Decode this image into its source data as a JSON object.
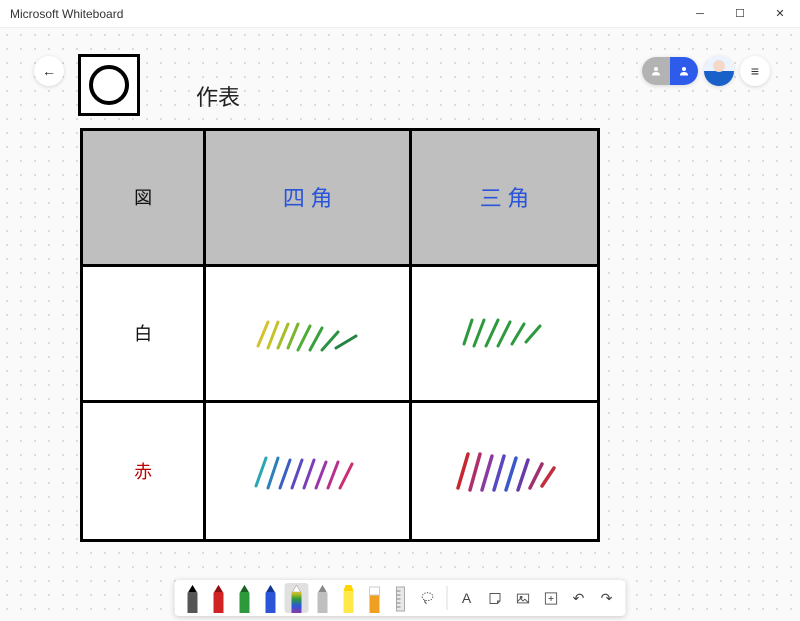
{
  "titlebar": {
    "title": "Microsoft Whiteboard"
  },
  "header": {
    "title_text": "作表",
    "share_mode_private_label": "Private",
    "share_mode_shared_label": "Shared"
  },
  "table": {
    "header": {
      "col1": "図",
      "col2": "四 角",
      "col3": "三 角"
    },
    "rows": [
      {
        "label": "白",
        "cell2_desc": "yellow-to-green crayon scribbles",
        "cell3_desc": "green crayon scribbles"
      },
      {
        "label": "赤",
        "cell2_desc": "teal-to-magenta rainbow crayon scribbles",
        "cell3_desc": "red/blue/purple rainbow crayon scribbles"
      }
    ]
  },
  "toolbar": {
    "pens": [
      {
        "name": "pen-black",
        "tip": "#000000",
        "body": "#555555",
        "selected": false
      },
      {
        "name": "pen-red",
        "tip": "#d02424",
        "body": "#d02424",
        "selected": false
      },
      {
        "name": "pen-green",
        "tip": "#2c9a3c",
        "body": "#2c9a3c",
        "selected": false
      },
      {
        "name": "pen-blue",
        "tip": "#2b55d9",
        "body": "#2b55d9",
        "selected": false
      },
      {
        "name": "pen-rainbow",
        "tip": "#ffffff",
        "body": "rainbow",
        "selected": true
      },
      {
        "name": "pen-gray-hi",
        "tip": "#9a9a9a",
        "body": "#bfbfbf",
        "selected": false
      },
      {
        "name": "highlighter",
        "tip": "#ffe94a",
        "body": "#ffe94a",
        "selected": false
      },
      {
        "name": "eraser",
        "tip": "#ffffff",
        "body": "#f0a020",
        "selected": false
      },
      {
        "name": "ruler",
        "tip": "#ffffff",
        "body": "#cfcfcf",
        "selected": false
      }
    ],
    "buttons": {
      "lasso": "Lasso",
      "text": "A",
      "note": "Note",
      "image": "Image",
      "add": "Add",
      "undo": "Undo",
      "redo": "Redo"
    }
  }
}
